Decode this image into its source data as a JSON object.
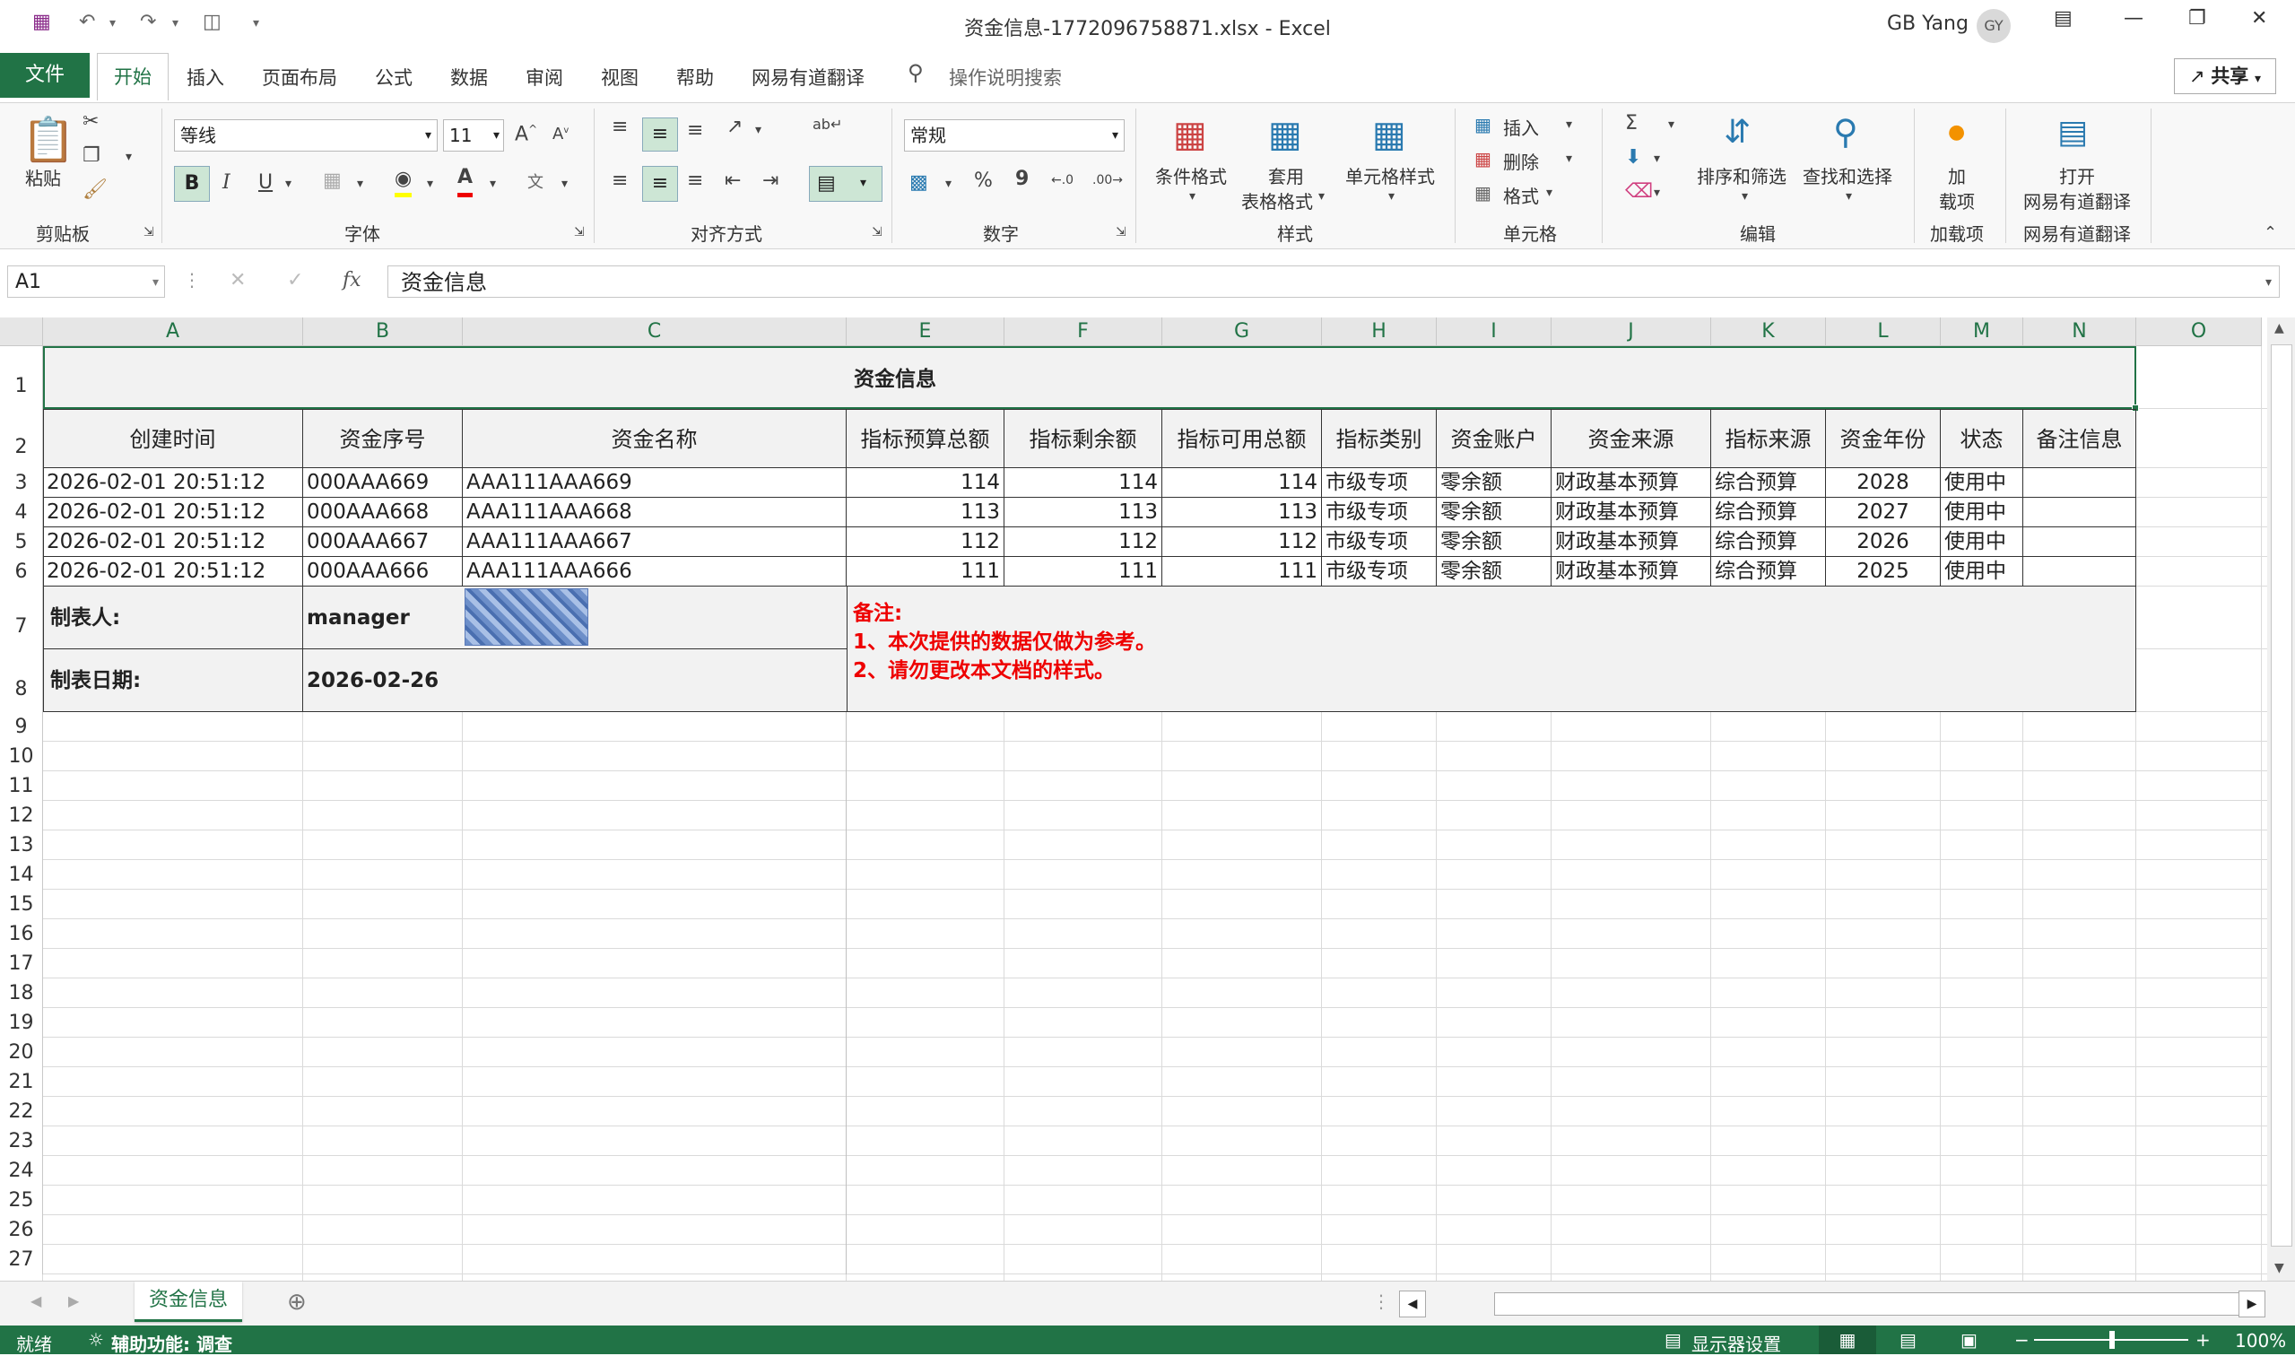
{
  "window": {
    "title": "资金信息-1772096758871.xlsx  -  Excel",
    "user_name": "GB Yang",
    "user_initials": "GY"
  },
  "tabs": {
    "file": "文件",
    "home": "开始",
    "items": [
      "插入",
      "页面布局",
      "公式",
      "数据",
      "审阅",
      "视图",
      "帮助",
      "网易有道翻译"
    ],
    "search": "操作说明搜索",
    "share": "共享"
  },
  "ribbon": {
    "clipboard": {
      "paste": "粘贴",
      "label": "剪贴板"
    },
    "font": {
      "name": "等线",
      "size": "11",
      "label": "字体",
      "bold": "B",
      "italic": "I",
      "underline": "U",
      "grow": "A",
      "shrink": "A"
    },
    "alignment": {
      "label": "对齐方式"
    },
    "number": {
      "format": "常规",
      "label": "数字",
      "percent": "%",
      "comma": "9"
    },
    "styles": {
      "conditional": "条件格式",
      "table_line1": "套用",
      "table_line2": "表格格式",
      "cell_styles": "单元格样式",
      "label": "样式"
    },
    "cells": {
      "insert": "插入",
      "delete": "删除",
      "format": "格式",
      "label": "单元格"
    },
    "editing": {
      "sort": "排序和筛选",
      "find": "查找和选择",
      "label": "编辑"
    },
    "addins": {
      "line1": "加",
      "line2": "载项",
      "label": "加载项"
    },
    "youdao": {
      "line1": "打开",
      "line2": "网易有道翻译",
      "label": "网易有道翻译"
    }
  },
  "formula_bar": {
    "name_box": "A1",
    "fx": "fx",
    "content": "资金信息"
  },
  "columns": [
    "A",
    "B",
    "C",
    "E",
    "F",
    "G",
    "H",
    "I",
    "J",
    "K",
    "L",
    "M",
    "N",
    "O"
  ],
  "rows": [
    "1",
    "2",
    "3",
    "4",
    "5",
    "6",
    "7",
    "8",
    "9",
    "10",
    "11",
    "12",
    "13",
    "14",
    "15",
    "16",
    "17",
    "18",
    "19",
    "20",
    "21",
    "22",
    "23",
    "24",
    "25",
    "26",
    "27"
  ],
  "sheet": {
    "title": "资金信息",
    "headers": [
      "创建时间",
      "资金序号",
      "资金名称",
      "指标预算总额",
      "指标剩余额",
      "指标可用总额",
      "指标类别",
      "资金账户",
      "资金来源",
      "指标来源",
      "资金年份",
      "状态",
      "备注信息"
    ],
    "data": [
      [
        "2026-02-01 20:51:12",
        "000AAA669",
        "AAA111AAA669",
        "114",
        "114",
        "114",
        "市级专项",
        "零余额",
        "财政基本预算",
        "综合预算",
        "2028",
        "使用中",
        ""
      ],
      [
        "2026-02-01 20:51:12",
        "000AAA668",
        "AAA111AAA668",
        "113",
        "113",
        "113",
        "市级专项",
        "零余额",
        "财政基本预算",
        "综合预算",
        "2027",
        "使用中",
        ""
      ],
      [
        "2026-02-01 20:51:12",
        "000AAA667",
        "AAA111AAA667",
        "112",
        "112",
        "112",
        "市级专项",
        "零余额",
        "财政基本预算",
        "综合预算",
        "2026",
        "使用中",
        ""
      ],
      [
        "2026-02-01 20:51:12",
        "000AAA666",
        "AAA111AAA666",
        "111",
        "111",
        "111",
        "市级专项",
        "零余额",
        "财政基本预算",
        "综合预算",
        "2025",
        "使用中",
        ""
      ]
    ],
    "maker_label": "制表人:",
    "maker_value": "manager",
    "date_label": "制表日期:",
    "date_value": "2026-02-26",
    "notes": [
      "备注:",
      "1、本次提供的数据仅做为参考。",
      "2、请勿更改本文档的样式。"
    ]
  },
  "sheet_tabs": [
    "资金信息"
  ],
  "status": {
    "ready": "就绪",
    "accessibility": "辅助功能: 调查",
    "display": "显示器设置",
    "zoom": "100%"
  },
  "colors": {
    "excel_green": "#217346",
    "note_red": "#ee0000",
    "header_bg": "#e6e6e6"
  }
}
